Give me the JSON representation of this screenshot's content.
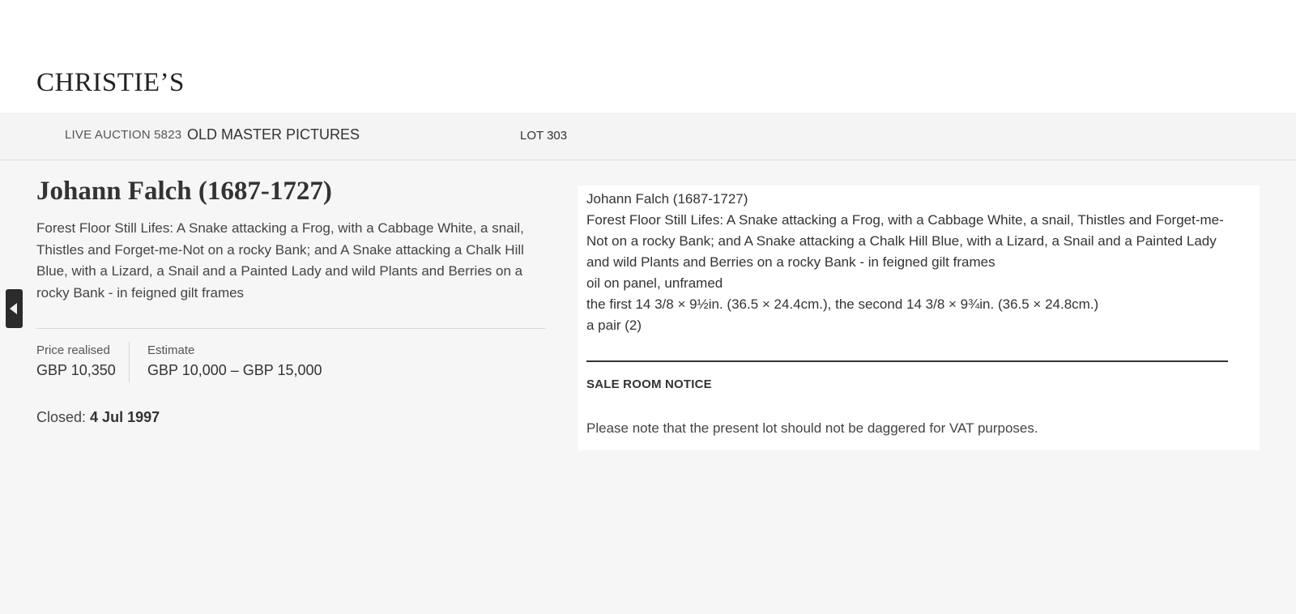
{
  "header": {
    "logo": "CHRISTIE’S"
  },
  "subnav": {
    "auction_label": "LIVE AUCTION 5823",
    "auction_title": "OLD MASTER PICTURES",
    "lot_label": "LOT 303"
  },
  "lot": {
    "artist": "Johann Falch (1687-1727)",
    "title": "Forest Floor Still Lifes: A Snake attacking a Frog, with a Cabbage White, a snail, Thistles and Forget-me-Not on a rocky Bank; and A Snake attacking a Chalk Hill Blue, with a Lizard, a Snail and a Painted Lady and wild Plants and Berries on a rocky Bank - in feigned gilt frames"
  },
  "price": {
    "realised_label": "Price realised",
    "realised_value": "GBP 10,350",
    "estimate_label": "Estimate",
    "estimate_value": "GBP 10,000 – GBP 15,000"
  },
  "closed": {
    "label": "Closed:",
    "date": "4 Jul 1997"
  },
  "details": {
    "artist": "Johann Falch (1687-1727)",
    "title": "Forest Floor Still Lifes: A Snake attacking a Frog, with a Cabbage White, a snail, Thistles and Forget-me-Not on a rocky Bank; and A Snake attacking a Chalk Hill Blue, with a Lizard, a Snail and a Painted Lady and wild Plants and Berries on a rocky Bank - in feigned gilt frames",
    "medium": "oil on panel, unframed",
    "dimensions": "the first 14 3/8 × 9½in. (36.5 × 24.4cm.), the second 14 3/8 × 9¾in. (36.5 × 24.8cm.)",
    "quantity": "a pair (2)"
  },
  "notice": {
    "heading": "SALE ROOM NOTICE",
    "text": "Please note that the present lot should not be daggered for VAT purposes."
  },
  "icons": {
    "side_toggle": "caret-left-icon"
  }
}
